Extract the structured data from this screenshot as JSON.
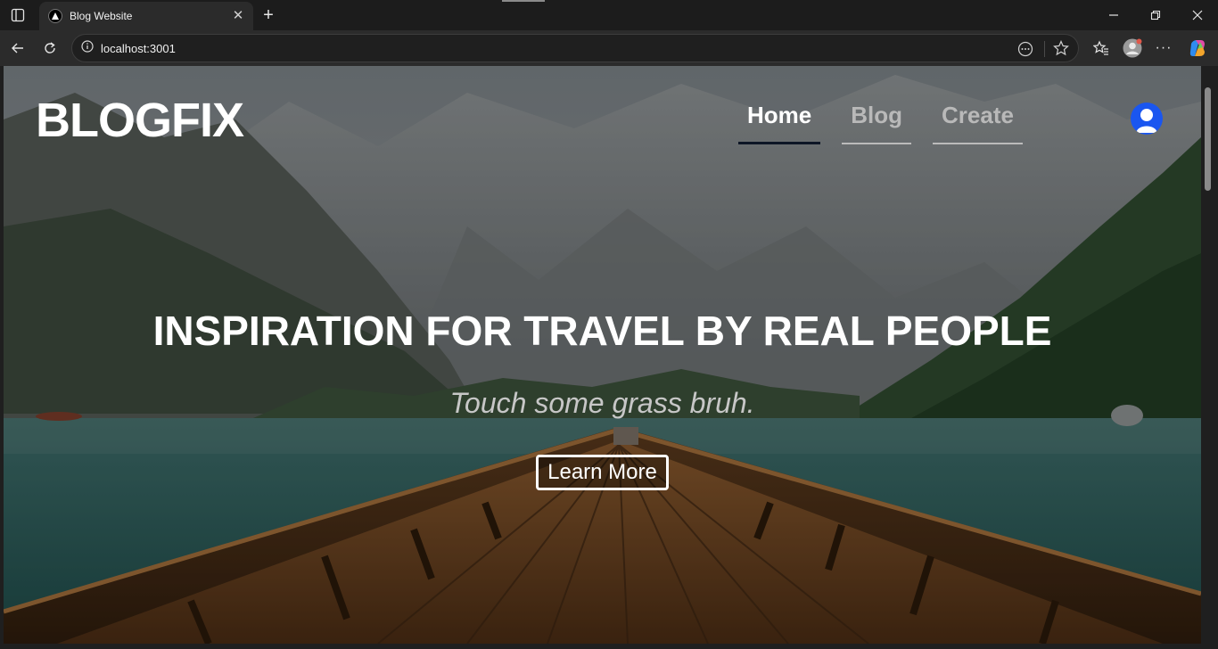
{
  "browser": {
    "tab_title": "Blog Website",
    "url": "localhost:3001"
  },
  "site": {
    "logo": "BLOGFIX",
    "nav": [
      {
        "label": "Home",
        "active": true
      },
      {
        "label": "Blog",
        "active": false
      },
      {
        "label": "Create",
        "active": false
      }
    ],
    "hero": {
      "headline": "INSPIRATION FOR TRAVEL BY REAL PEOPLE",
      "tagline": "Touch some grass bruh.",
      "cta_label": "Learn More"
    }
  },
  "colors": {
    "avatar_bg": "#1a56f0",
    "active_underline": "#0d1626"
  }
}
